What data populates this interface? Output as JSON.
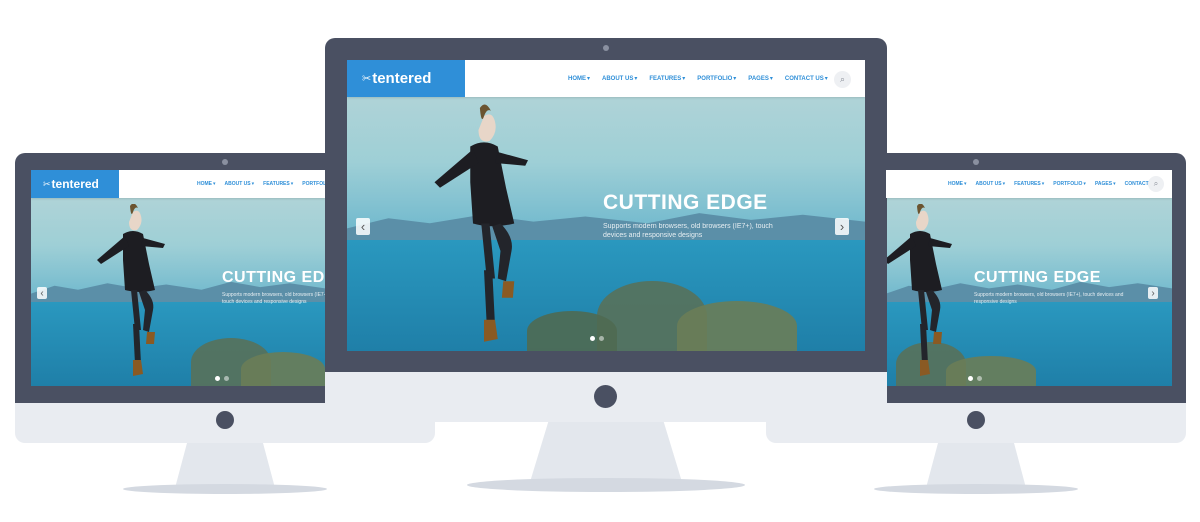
{
  "site": {
    "logo_icon": "✂",
    "logo_text": "tentered",
    "nav": [
      "HOME",
      "ABOUT US",
      "FEATURES",
      "PORTFOLIO",
      "PAGES",
      "CONTACT US"
    ],
    "search_icon": "search-icon"
  },
  "slide": {
    "title": "CUTTING EDGE",
    "text": "Supports modern browsers, old browsers (IE7+), touch devices and responsive designs",
    "prev": "‹",
    "next": "›"
  },
  "colors": {
    "bezel": "#4a5062",
    "chin": "#e9ecf1",
    "logo_bg": "#2f8fd8",
    "nav_text": "#2f8fd8"
  }
}
